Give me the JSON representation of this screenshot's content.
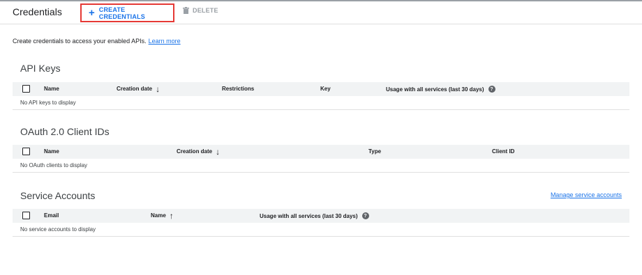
{
  "header": {
    "title": "Credentials",
    "create_label": "CREATE CREDENTIALS",
    "create_icon": "plus-icon",
    "delete_label": "DELETE",
    "delete_icon": "trash-icon"
  },
  "intro": {
    "text": "Create credentials to access your enabled APIs.",
    "link": "Learn more"
  },
  "api_keys": {
    "title": "API Keys",
    "columns": {
      "name": "Name",
      "creation_date": "Creation date",
      "restrictions": "Restrictions",
      "key": "Key",
      "usage": "Usage with all services (last 30 days)"
    },
    "empty_text": "No API keys to display"
  },
  "oauth": {
    "title": "OAuth 2.0 Client IDs",
    "columns": {
      "name": "Name",
      "creation_date": "Creation date",
      "type": "Type",
      "client_id": "Client ID"
    },
    "empty_text": "No OAuth clients to display"
  },
  "service_accounts": {
    "title": "Service Accounts",
    "manage_link": "Manage service accounts",
    "columns": {
      "email": "Email",
      "name": "Name",
      "usage": "Usage with all services (last 30 days)"
    },
    "empty_text": "No service accounts to display"
  },
  "colors": {
    "accent": "#1a73e8",
    "highlight_border": "#e53935",
    "table_header_bg": "#f1f3f4"
  }
}
